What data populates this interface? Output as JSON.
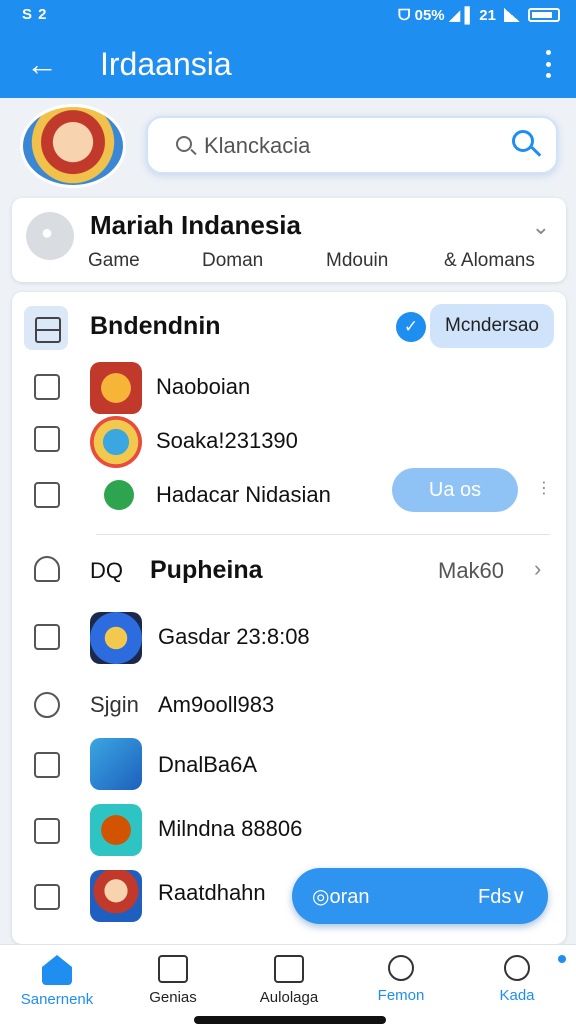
{
  "status": {
    "left": "S 2",
    "right": "ᗜ 05%  ◢  ▌ 21"
  },
  "header": {
    "title": "Irdaansia"
  },
  "search": {
    "placeholder": "Klanckacia"
  },
  "profile": {
    "name": "Mariah Indanesia",
    "tabs": [
      "Game",
      "Doman",
      "Mdouin",
      "& Alomans"
    ]
  },
  "section1": {
    "title": "Bndendnin",
    "badge_label": "Mcndersao",
    "items": [
      {
        "label": "Naoboian"
      },
      {
        "label": "Soaka!231390"
      },
      {
        "label": "Hadacar Nidasian",
        "button": "Ua os"
      }
    ]
  },
  "section2": {
    "prefix": "DQ",
    "title": "Pupheina",
    "right_label": "Mak60",
    "items": [
      {
        "label": "Gasdar 23:8:08"
      },
      {
        "prefix": "Sjgin",
        "label": "Am9ooll983"
      },
      {
        "label": "DnalBa6A"
      },
      {
        "label": "Milndna 88806"
      },
      {
        "label": "Raatdhahn"
      }
    ]
  },
  "fab": {
    "left": "◎oran",
    "right": "Fds∨"
  },
  "bottom_nav": [
    {
      "label": "Sanernenk"
    },
    {
      "label": "Genias"
    },
    {
      "label": "Aulolaga"
    },
    {
      "label": "Femon"
    },
    {
      "label": "Kada"
    }
  ],
  "colors": {
    "accent": "#1f8ef1",
    "background": "#eef2f7"
  }
}
